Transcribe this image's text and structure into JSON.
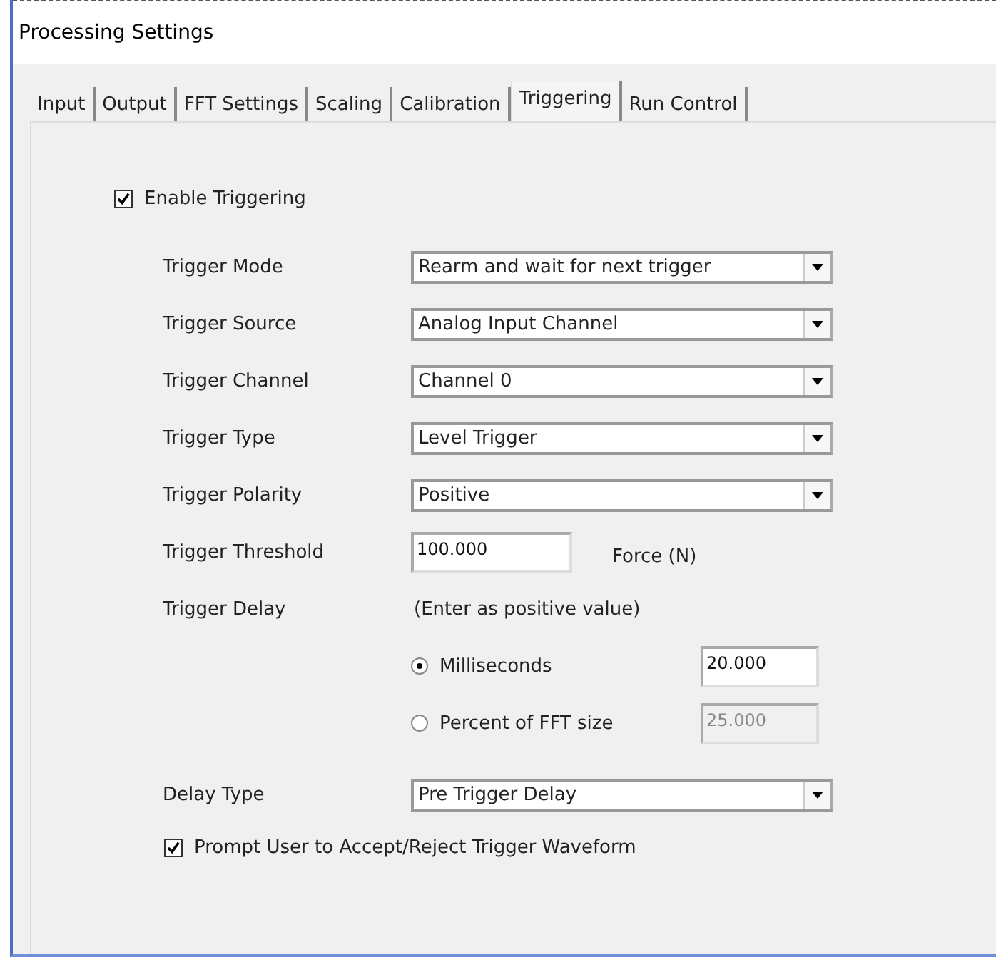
{
  "window": {
    "title": "Processing Settings"
  },
  "tabs": [
    {
      "label": "Input",
      "selected": false
    },
    {
      "label": "Output",
      "selected": false
    },
    {
      "label": "FFT Settings",
      "selected": false
    },
    {
      "label": "Scaling",
      "selected": false
    },
    {
      "label": "Calibration",
      "selected": false
    },
    {
      "label": "Triggering",
      "selected": true
    },
    {
      "label": "Run Control",
      "selected": false
    }
  ],
  "enable_triggering": {
    "label": "Enable Triggering",
    "checked": true
  },
  "settings": [
    {
      "kind": "dropdown",
      "label": "Trigger Mode",
      "value": "Rearm and wait for next trigger"
    },
    {
      "kind": "dropdown",
      "label": "Trigger Source",
      "value": "Analog Input Channel"
    },
    {
      "kind": "dropdown",
      "label": "Trigger Channel",
      "value": "Channel 0"
    },
    {
      "kind": "dropdown",
      "label": "Trigger Type",
      "value": "Level Trigger"
    },
    {
      "kind": "dropdown",
      "label": "Trigger Polarity",
      "value": "Positive"
    },
    {
      "kind": "text",
      "label": "Trigger Threshold",
      "value": "100.000",
      "unit": "Force (N)"
    },
    {
      "kind": "note",
      "label": "Trigger Delay",
      "note": "(Enter as positive value)"
    }
  ],
  "delay_units": [
    {
      "label": "Milliseconds",
      "selected": true,
      "value": "20.000",
      "disabled": false
    },
    {
      "label": "Percent of FFT size",
      "selected": false,
      "value": "25.000",
      "disabled": true
    }
  ],
  "delay_type": {
    "label": "Delay Type",
    "value": "Pre Trigger Delay"
  },
  "prompt": {
    "label": "Prompt User to Accept/Reject Trigger Waveform",
    "checked": true
  }
}
